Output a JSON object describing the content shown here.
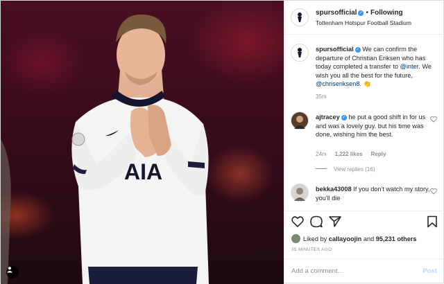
{
  "post": {
    "username": "spursofficial",
    "following_label": "Following",
    "location": "Tottenham Hotspur Football Stadium",
    "caption": {
      "username": "spursofficial",
      "text_part1": "We can confirm the departure of Christian Eriksen who has today completed a transfer to ",
      "mention1": "@inter",
      "text_part2": ". We wish you all the best for the future, ",
      "mention2": "@chriseriksen8",
      "text_part3": ". 👏",
      "time": "35m"
    },
    "comments": [
      {
        "username": "ajtracey",
        "text": "he put a good shift in for us and was a lovely guy. but his time was done, wishing him the best.",
        "time": "24m",
        "likes": "1,222 likes",
        "reply_label": "Reply",
        "view_replies": "View replies (16)"
      },
      {
        "username": "bekka43008",
        "text": "If you don't watch my story, you'll die"
      }
    ],
    "likes": {
      "prefix": "Liked by",
      "first_user": "callayoojin",
      "joiner": "and",
      "count": "95,231 others"
    },
    "timestamp": "35 MINUTES AGO",
    "add_comment_placeholder": "Add a comment...",
    "post_button": "Post",
    "shirt_text": "AIA"
  },
  "colors": {
    "verified": "#3897f0",
    "link": "#00376b",
    "muted": "#8e8e8e",
    "post_disabled": "#b3dbff"
  },
  "icons": [
    "heart-icon",
    "comment-icon",
    "share-icon",
    "bookmark-icon",
    "user-tag-icon",
    "verified-icon",
    "spurs-logo-icon"
  ]
}
